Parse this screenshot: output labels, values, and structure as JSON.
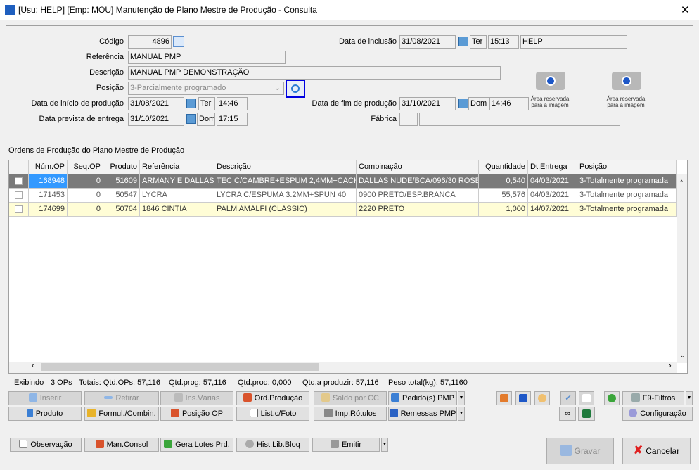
{
  "window": {
    "title": "[Usu: HELP] [Emp: MOU] Manutenção de Plano Mestre de Produção - Consulta",
    "close": "✕"
  },
  "form": {
    "codigo_label": "Código",
    "codigo": "4896",
    "referencia_label": "Referência",
    "referencia": "MANUAL PMP",
    "descricao_label": "Descrição",
    "descricao": "MANUAL PMP DEMONSTRAÇÃO",
    "posicao_label": "Posição",
    "posicao": "3-Parcialmente programado",
    "inicio_label": "Data de início de produção",
    "inicio_data": "31/08/2021",
    "inicio_dia": "Ter",
    "inicio_hora": "14:46",
    "prevista_label": "Data prevista de entrega",
    "prevista_data": "31/10/2021",
    "prevista_dia": "Dom",
    "prevista_hora": "17:15",
    "inclusao_label": "Data de inclusão",
    "inclusao_data": "31/08/2021",
    "inclusao_dia": "Ter",
    "inclusao_hora": "15:13",
    "inclusao_usuario": "HELP",
    "fim_label": "Data de fim de produção",
    "fim_data": "31/10/2021",
    "fim_dia": "Dom",
    "fim_hora": "14:46",
    "fabrica_label": "Fábrica",
    "fabrica_cod": "",
    "fabrica_nome": "",
    "imagem1": "Área reservada para a imagem",
    "imagem2": "Área reservada para a imagem"
  },
  "grid": {
    "title": "Ordens de Produção do Plano Mestre de Produção",
    "columns": [
      "Núm.OP",
      "Seq.OP",
      "Produto",
      "Referência",
      "Descrição",
      "Combinação",
      "Quantidade",
      "Dt.Entrega",
      "Posição"
    ],
    "rows": [
      [
        "168948",
        "0",
        "51609",
        "ARMANY E DALLAS",
        "TEC C/CAMBRE+ESPUM 2,4MM+CACH",
        "DALLAS NUDE/BCA/096/30 ROSE",
        "0,540",
        "04/03/2021",
        "3-Totalmente programada"
      ],
      [
        "171453",
        "0",
        "50547",
        "LYCRA",
        "LYCRA C/ESPUMA 3.2MM+SPUN 40",
        "0900 PRETO/ESP.BRANCA",
        "55,576",
        "04/03/2021",
        "3-Totalmente programada"
      ],
      [
        "174699",
        "0",
        "50764",
        "1846 CINTIA",
        "PALM AMALFI (CLASSIC)",
        "2220 PRETO",
        "1,000",
        "14/07/2021",
        "3-Totalmente programada"
      ]
    ]
  },
  "status": {
    "exibindo": "Exibindo",
    "ops": "3 OPs",
    "totais": "Totais: Qtd.OPs: 57,116",
    "prog": "Qtd.prog: 57,116",
    "prod": "Qtd.prod: 0,000",
    "aproduzir": "Qtd.a produzir: 57,116",
    "peso": "Peso total(kg): 57,1160"
  },
  "buttons": {
    "inserir": "Inserir",
    "retirar": "Retirar",
    "ins_varias": "Ins.Várias",
    "ord_producao": "Ord.Produção",
    "saldo_cc": "Saldo por CC",
    "pedidos_pmp": "Pedido(s) PMP",
    "produto": "Produto",
    "formul": "Formul./Combin.",
    "posicao_op": "Posição OP",
    "list_foto": "List.c/Foto",
    "imp_rotulos": "Imp.Rótulos",
    "remessas": "Remessas PMP",
    "filtros": "F9-Filtros",
    "configuracao": "Configuração",
    "observacao": "Observação",
    "man_consol": "Man.Consol",
    "gera_lotes": "Gera Lotes Prd.",
    "hist_lib": "Hist.Lib.Bloq",
    "emitir": "Emitir",
    "gravar": "Gravar",
    "cancelar": "Cancelar"
  }
}
